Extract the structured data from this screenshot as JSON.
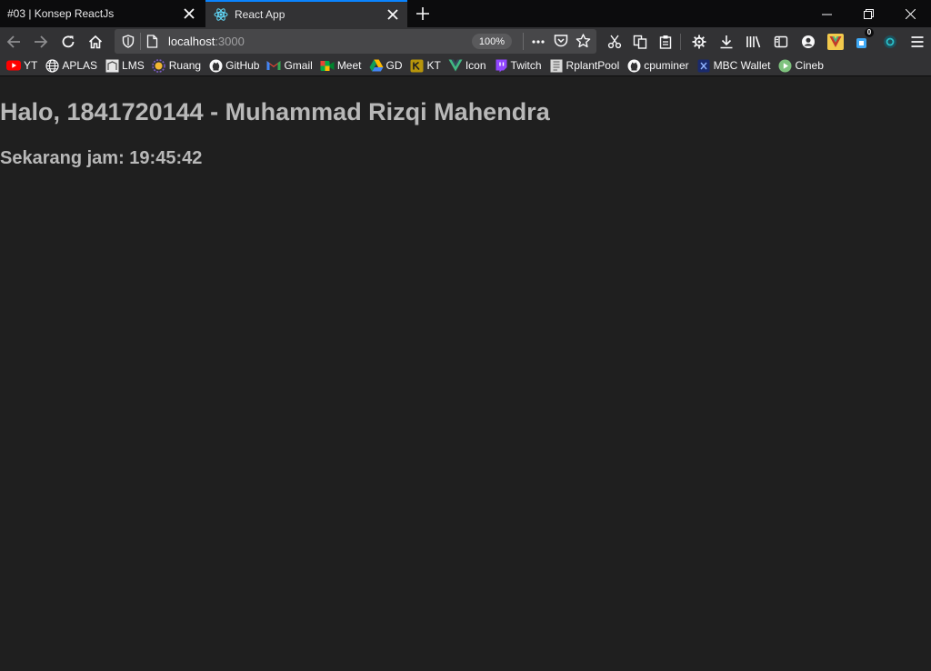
{
  "tabs": [
    {
      "title": "#03 | Konsep ReactJs",
      "active": false
    },
    {
      "title": "React App",
      "active": true
    }
  ],
  "navbar": {
    "url_host": "localhost",
    "url_port": ":3000",
    "zoom": "100%"
  },
  "toolbar": {
    "extension_badge": "0"
  },
  "bookmarks": [
    {
      "label": "YT",
      "icon": "youtube-icon"
    },
    {
      "label": "APLAS",
      "icon": "globe-icon"
    },
    {
      "label": "LMS",
      "icon": "lms-icon"
    },
    {
      "label": "Ruang",
      "icon": "ruang-icon"
    },
    {
      "label": "GitHub",
      "icon": "github-icon"
    },
    {
      "label": "Gmail",
      "icon": "gmail-icon"
    },
    {
      "label": "Meet",
      "icon": "meet-icon"
    },
    {
      "label": "GD",
      "icon": "google-drive-icon"
    },
    {
      "label": "KT",
      "icon": "kt-icon"
    },
    {
      "label": "Icon",
      "icon": "vue-icon"
    },
    {
      "label": "Twitch",
      "icon": "twitch-icon"
    },
    {
      "label": "RplantPool",
      "icon": "rplant-icon"
    },
    {
      "label": "cpuminer",
      "icon": "github-icon"
    },
    {
      "label": "MBC Wallet",
      "icon": "mbc-icon"
    },
    {
      "label": "Cineb",
      "icon": "cineb-icon"
    }
  ],
  "page": {
    "greeting": "Halo, 1841720144 - Muhammad Rizqi Mahendra",
    "clock": "Sekarang jam: 19:45:42"
  },
  "colors": {
    "accent": "#0a84ff",
    "page_bg": "#1f1f1f",
    "text": "#b8b8b8",
    "chrome": "#323234"
  }
}
